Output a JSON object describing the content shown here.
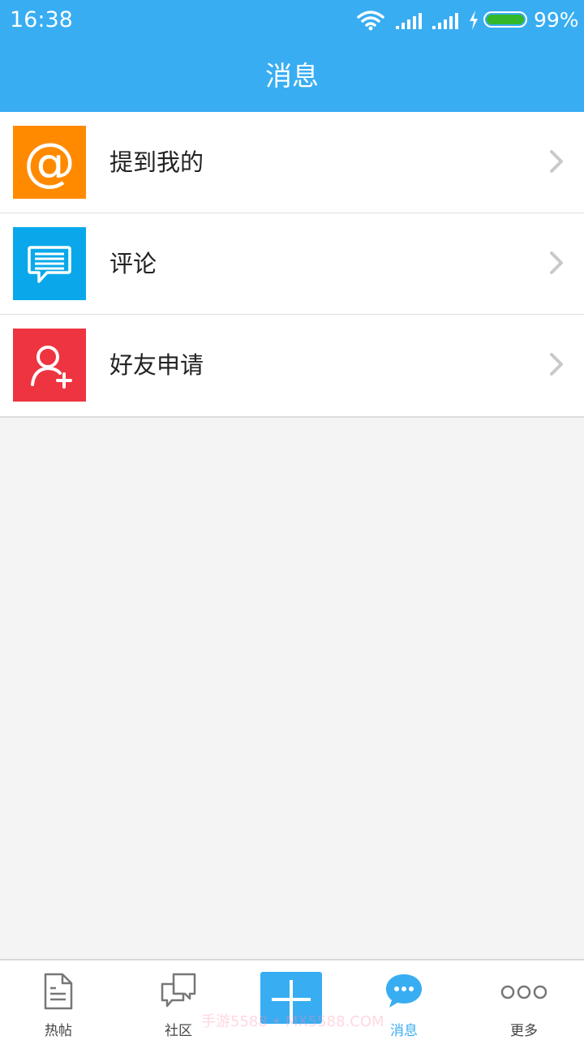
{
  "status_bar": {
    "time": "16:38",
    "battery_percent": "99%",
    "battery_level": 0.99
  },
  "header": {
    "title": "消息"
  },
  "messages": {
    "items": [
      {
        "label": "提到我的",
        "icon": "at-icon",
        "color": "#ff8a00"
      },
      {
        "label": "评论",
        "icon": "comment-icon",
        "color": "#0aa8ea"
      },
      {
        "label": "好友申请",
        "icon": "add-friend-icon",
        "color": "#ee3440"
      }
    ]
  },
  "tabbar": {
    "tabs": [
      {
        "label": "热帖",
        "icon": "document-icon"
      },
      {
        "label": "社区",
        "icon": "chat-bubbles-icon"
      },
      {
        "label": "",
        "icon": "plus-icon"
      },
      {
        "label": "消息",
        "icon": "message-icon",
        "active": true
      },
      {
        "label": "更多",
        "icon": "more-icon"
      }
    ]
  },
  "watermark": "手游5588 • MX5588.COM",
  "colors": {
    "accent": "#38adf2",
    "background": "#f4f4f4"
  }
}
